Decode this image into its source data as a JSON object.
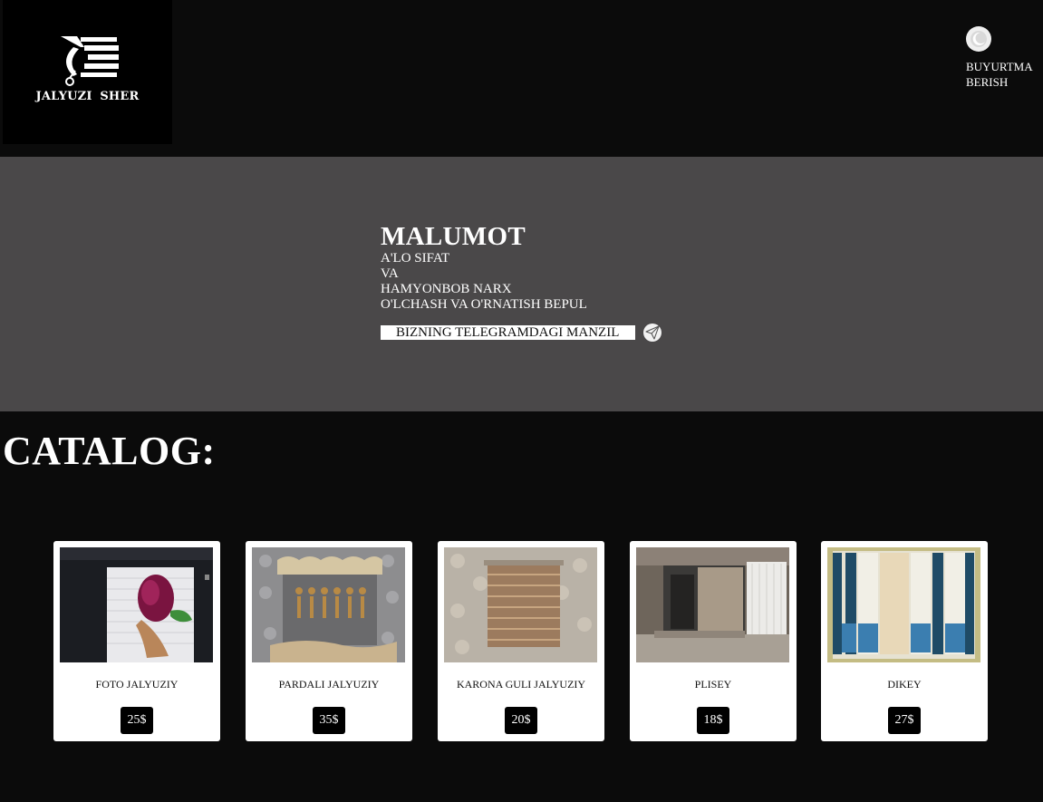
{
  "header": {
    "logo_text": "JALYUZI  SHER",
    "order_label_line1": "BUYURTMA",
    "order_label_line2": "BERISH",
    "order_icon": "moon-icon"
  },
  "info": {
    "title": "MALUMOT",
    "lines": [
      "A'LO SIFAT",
      "VA",
      "HAMYONBOB NARX",
      "O'LCHASH VA O'RNATISH BEPUL"
    ],
    "telegram_button": "BIZNING TELEGRAMDAGI MANZIL",
    "telegram_icon": "paper-plane-icon"
  },
  "catalog": {
    "title": "CATALOG:",
    "items": [
      {
        "name": "FOTO JALYUZIY",
        "price": "25$"
      },
      {
        "name": "PARDALI JALYUZIY",
        "price": "35$"
      },
      {
        "name": "KARONA GULI JALYUZIY",
        "price": "20$"
      },
      {
        "name": "PLISEY",
        "price": "18$"
      },
      {
        "name": "DIKEY",
        "price": "27$"
      }
    ]
  },
  "colors": {
    "page_bg": "#0b0b0b",
    "info_bg": "#4a4849",
    "card_bg": "#ffffff",
    "price_bg": "#000000"
  }
}
